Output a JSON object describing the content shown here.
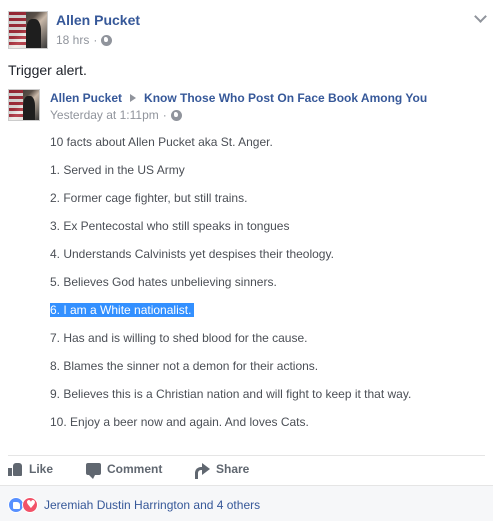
{
  "post": {
    "author": "Allen Pucket",
    "time": "18 hrs",
    "separator": "·",
    "text": "Trigger alert."
  },
  "shared": {
    "author": "Allen Pucket",
    "target": "Know Those Who Post On Face Book Among You",
    "time": "Yesterday at 1:11pm",
    "separator": "·",
    "lines": [
      "10 facts about Allen Pucket aka St. Anger.",
      "1. Served in the US Army",
      "2. Former cage fighter, but still trains.",
      "3. Ex Pentecostal who still speaks in tongues",
      "4. Understands Calvinists yet despises their theology.",
      "5. Believes God hates unbelieving sinners.",
      "6. I am a White nationalist.",
      "7. Has and is willing to shed blood for the cause.",
      "8. Blames the sinner not a demon for their actions.",
      "9. Believes this is a Christian nation and will fight to keep it that way.",
      "10. Enjoy a beer now and again. And loves Cats."
    ],
    "highlighted_index": 6
  },
  "actions": {
    "like": "Like",
    "comment": "Comment",
    "share": "Share"
  },
  "reactions": {
    "text": "Jeremiah Dustin Harrington and 4 others",
    "types": [
      "like-icon",
      "love-icon"
    ]
  },
  "colors": {
    "link": "#365899",
    "meta": "#90949c",
    "highlight": "#3390ff"
  }
}
